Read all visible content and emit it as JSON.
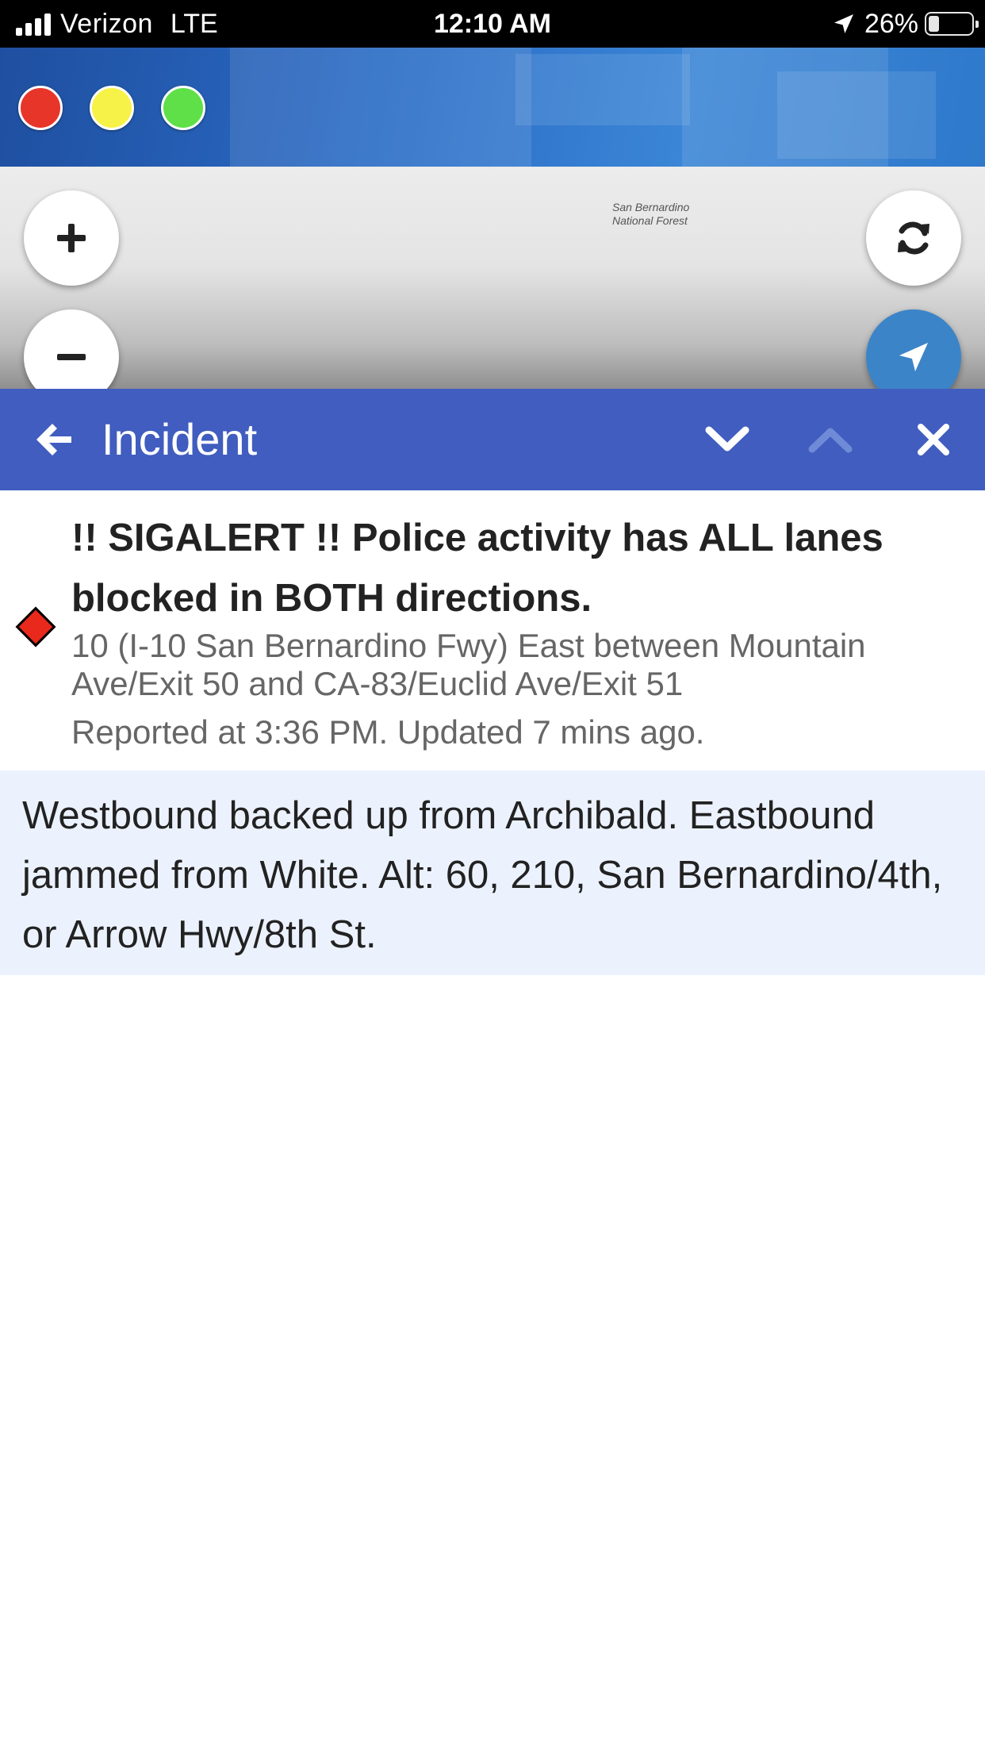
{
  "status_bar": {
    "carrier": "Verizon",
    "network": "LTE",
    "time": "12:10 AM",
    "battery": "26%",
    "battery_level": 0.26,
    "icons": [
      "signal-icon",
      "location-arrow-icon",
      "battery-icon"
    ]
  },
  "banner": {
    "dots": [
      {
        "name": "red-filter-dot",
        "color": "#e8352a"
      },
      {
        "name": "yellow-filter-dot",
        "color": "#f7f247"
      },
      {
        "name": "green-filter-dot",
        "color": "#5fe049"
      }
    ]
  },
  "map": {
    "label_line1": "San Bernardino",
    "label_line2": "National Forest",
    "buttons": [
      "plus-icon",
      "minus-icon",
      "refresh-icon",
      "navigate-icon"
    ]
  },
  "incident_bar": {
    "title": "Incident",
    "icons": [
      "back-arrow-icon",
      "chevron-down-icon",
      "chevron-up-icon",
      "close-icon"
    ],
    "color": "#405dbf"
  },
  "incident": {
    "headline": "!! SIGALERT !! Police activity has ALL lanes blocked in BOTH directions.",
    "location": "10 (I-10 San Bernardino Fwy) East between Mountain Ave/Exit 50 and CA-83/Euclid Ave/Exit 51",
    "reported": "Reported at 3:36 PM. Updated 7 mins ago.",
    "severity_color": "#e8291c",
    "description": "Westbound backed up from Archibald. Eastbound jammed from White. Alt: 60, 210, San Bernardino/4th, or Arrow Hwy/8th St."
  }
}
